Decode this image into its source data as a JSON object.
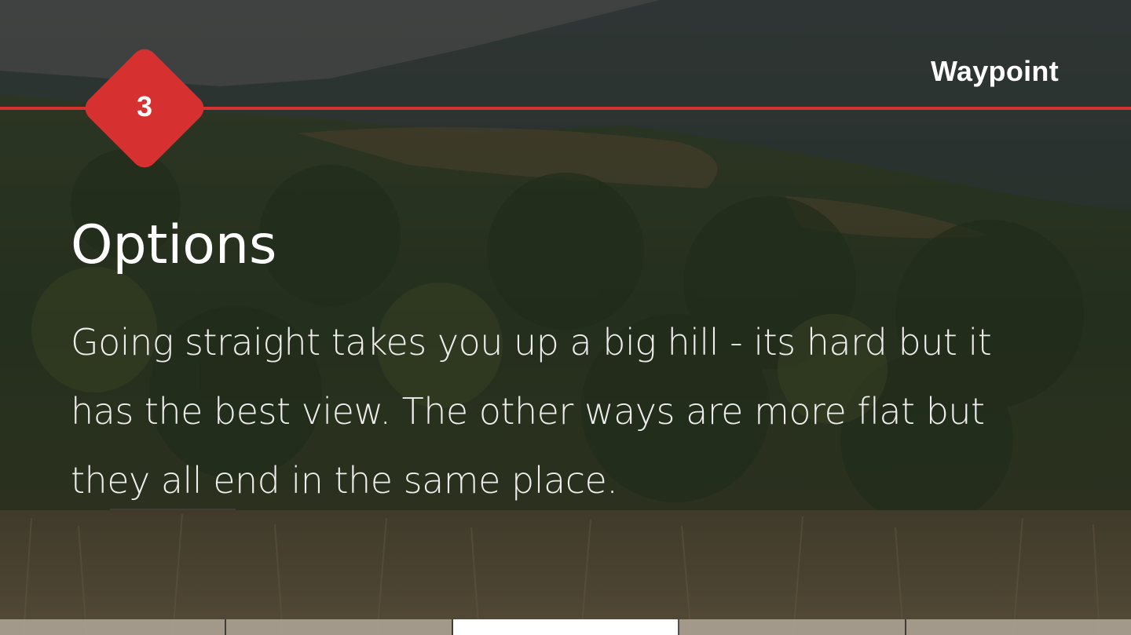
{
  "header": {
    "brand": "Waypoint",
    "step_number": "3",
    "accent_color": "#d63031"
  },
  "content": {
    "title": "Options",
    "body": "Going straight takes you up a big hill - its hard but it has the best view. The other ways are more flat but they all end in the same place."
  },
  "pager": {
    "total_tabs": 5,
    "active_index": 2
  }
}
